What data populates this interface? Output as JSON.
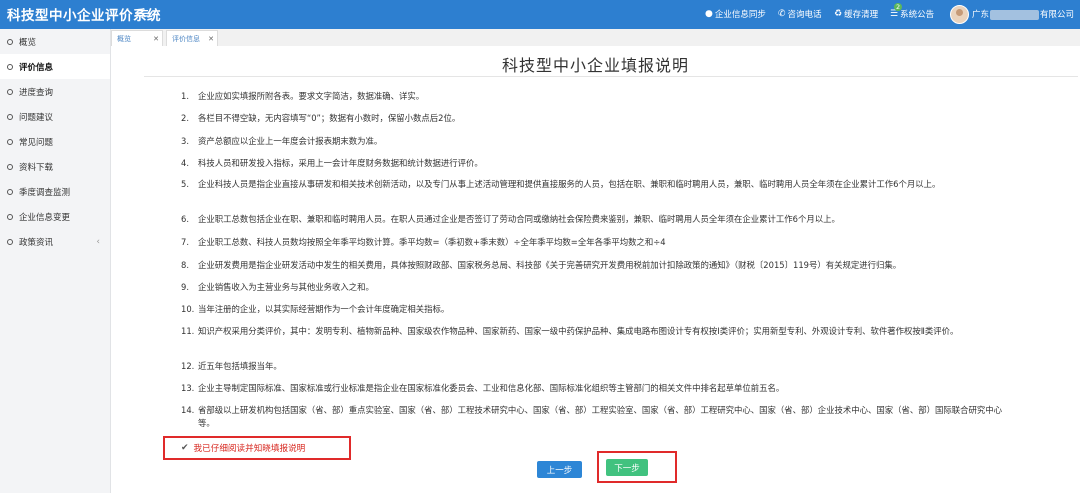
{
  "header": {
    "app_title": "科技型中小企业评价系统",
    "menu_icon": "hamburger-icon",
    "nav": [
      {
        "label": "企业信息同步",
        "icon": "user-icon"
      },
      {
        "label": "咨询电话",
        "icon": "phone-icon"
      },
      {
        "label": "缓存清理",
        "icon": "recycle-icon"
      },
      {
        "label": "系统公告",
        "icon": "notice-icon",
        "badge": "2"
      }
    ],
    "company_prefix": "广东",
    "company_suffix": "有限公司"
  },
  "sidebar": {
    "items": [
      {
        "label": "概览"
      },
      {
        "label": "评价信息"
      },
      {
        "label": "进度查询"
      },
      {
        "label": "问题建议"
      },
      {
        "label": "常见问题"
      },
      {
        "label": "资料下载"
      },
      {
        "label": "季度调查监测"
      },
      {
        "label": "企业信息变更"
      },
      {
        "label": "政策资讯"
      }
    ],
    "chevron": "‹"
  },
  "tabs": [
    {
      "label": "概览"
    },
    {
      "label": "评价信息"
    }
  ],
  "main": {
    "title": "科技型中小企业填报说明",
    "items": [
      {
        "num": "1.",
        "text": "企业应如实填报所附各表。要求文字简洁，数据准确、详实。"
      },
      {
        "num": "2.",
        "text": "各栏目不得空缺，无内容填写“0”；数据有小数时，保留小数点后2位。"
      },
      {
        "num": "3.",
        "text": "资产总额应以企业上一年度会计报表期末数为准。"
      },
      {
        "num": "4.",
        "text": "科技人员和研发投入指标，采用上一会计年度财务数据和统计数据进行评价。"
      },
      {
        "num": "5.",
        "text": "企业科技人员是指企业直接从事研发和相关技术创新活动，以及专门从事上述活动管理和提供直接服务的人员，包括在职、兼职和临时聘用人员，兼职、临时聘用人员全年须在企业累计工作6个月以上。"
      },
      {
        "num": "6.",
        "text": "企业职工总数包括企业在职、兼职和临时聘用人员。在职人员通过企业是否签订了劳动合同或缴纳社会保险费来鉴别，兼职、临时聘用人员全年须在企业累计工作6个月以上。"
      },
      {
        "num": "7.",
        "text": "企业职工总数、科技人员数均按照全年季平均数计算。季平均数=（季初数+季末数）÷全年季平均数=全年各季平均数之和÷4"
      },
      {
        "num": "8.",
        "text": "企业研发费用是指企业研发活动中发生的相关费用，具体按照财政部、国家税务总局、科技部《关于完善研究开发费用税前加计扣除政策的通知》（财税〔2015〕119号）有关规定进行归集。"
      },
      {
        "num": "9.",
        "text": "企业销售收入为主营业务与其他业务收入之和。"
      },
      {
        "num": "10.",
        "text": "当年注册的企业，以其实际经营期作为一个会计年度确定相关指标。"
      },
      {
        "num": "11.",
        "text": "知识产权采用分类评价，其中：发明专利、植物新品种、国家级农作物品种、国家新药、国家一级中药保护品种、集成电路布图设计专有权按Ⅰ类评价；实用新型专利、外观设计专利、软件著作权按Ⅱ类评价。"
      },
      {
        "num": "12.",
        "text": "近五年包括填报当年。"
      },
      {
        "num": "13.",
        "text": "企业主导制定国际标准、国家标准或行业标准是指企业在国家标准化委员会、工业和信息化部、国际标准化组织等主管部门的相关文件中排名起草单位前五名。"
      },
      {
        "num": "14.",
        "text": "省部级以上研发机构包括国家（省、部）重点实验室、国家（省、部）工程技术研究中心、国家（省、部）工程实验室、国家（省、部）工程研究中心、国家（省、部）企业技术中心、国家（省、部）国际联合研究中心等。"
      }
    ],
    "agree_label": "我已仔细阅读并知晓填报说明",
    "agree_checked": true,
    "prev_label": "上一步",
    "next_label": "下一步"
  },
  "colors": {
    "header_bg": "#2d7fd0",
    "prev_button": "#2d86d6",
    "next_button": "#41c27f",
    "highlight_border": "#e02a2a",
    "agree_text": "#d7261e"
  }
}
